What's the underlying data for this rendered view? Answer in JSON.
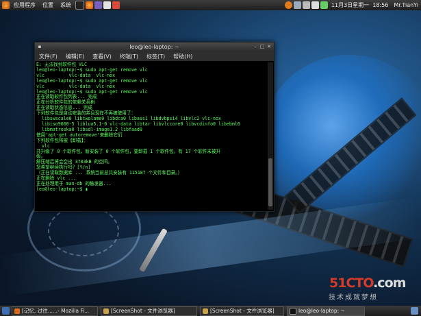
{
  "top_panel": {
    "menus": [
      "应用程序",
      "位置",
      "系统"
    ],
    "datetime": "11月3日星期一  18:56",
    "user": "Mr.TianYi"
  },
  "terminal": {
    "title": "leo@leo-laptop: ~",
    "menus": [
      "文件(F)",
      "编辑(E)",
      "查看(V)",
      "终端(T)",
      "标签(T)",
      "帮助(H)"
    ],
    "lines": [
      "E: 无法找到软件包 VLC",
      "leo@leo-laptop:~$ sudo apt-get remove vlc",
      "vlc         vlc-data  vlc-nox",
      "leo@leo-laptop:~$ sudo apt-get remove vlc",
      "vlc         vlc-data  vlc-nox",
      "leo@leo-laptop:~$ sudo apt-get remove vlc",
      "正在读取软件包列表... 完成",
      "正在分析软件包的依赖关系树",
      "正在读取状态信息... 完成",
      "下列软件包是自动安装的并且现在不再被使用了：",
      "  libswscale0 libtwolame0 libdca0 libass1 libdvbpsi4 libvlc2 vlc-nox",
      "  libiso9660-5 liblua5.1-0 vlc-data libtar libvlccore0 libvcdinfo0 libebml0",
      "  libmatroska0 libsdl-image1.2 libfaad0",
      "使用'apt-get autoremove'来删除它们",
      "下列软件包将被【卸载】：",
      "  vlc",
      "共升级了 0 个软件包，新安装了 0 个软件包，要卸载 1 个软件包，有 17 个软件未被升",
      "级。",
      "解压缩后将会空出 3703kB 的空间。",
      "您希望继续执行吗？[Y/n]",
      "（正在读取数据库 ... 系统当前总共安装有 115187 个文件和目录。）",
      "正在删除 vlc ...",
      "正在处理用于 man-db 的触发器...",
      "leo@leo-laptop:~$ ▮"
    ]
  },
  "taskbar": {
    "items": [
      "[记忆, 过往......- Mozilla Fi...",
      "[ScreenShot - 文件浏览器]",
      "[ScreenShot - 文件浏览器]",
      "leo@leo-laptop: ~"
    ]
  },
  "watermark": {
    "text_a": "51CTO",
    "text_b": ".com",
    "sub": "技术成就梦想"
  },
  "colors": {
    "terminal_text": "#5cff5c",
    "panel_bg": "#2a2a2a",
    "watermark_red": "#d53a2a"
  }
}
